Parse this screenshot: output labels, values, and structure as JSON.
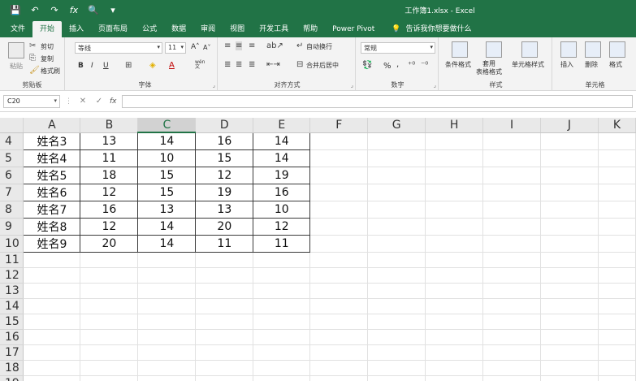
{
  "window": {
    "title": "工作簿1.xlsx  -  Excel"
  },
  "qat": {
    "save": "💾",
    "undo": "↶",
    "redo": "↷",
    "fx": "fx",
    "preview": "🔍",
    "more": "▾"
  },
  "tabs": [
    "文件",
    "开始",
    "插入",
    "页面布局",
    "公式",
    "数据",
    "审阅",
    "视图",
    "开发工具",
    "帮助",
    "Power Pivot"
  ],
  "active_tab": "开始",
  "tellme": {
    "icon": "💡",
    "text": "告诉我你想要做什么"
  },
  "ribbon": {
    "clipboard": {
      "label": "剪贴板",
      "paste": "粘贴",
      "cut": "剪切",
      "copy": "复制",
      "format_painter": "格式刷"
    },
    "font": {
      "label": "字体",
      "name": "等线",
      "size": "11",
      "grow": "A˄",
      "shrink": "A˅",
      "bold": "B",
      "italic": "I",
      "underline": "U",
      "wen": "wén\n文"
    },
    "alignment": {
      "label": "对齐方式",
      "wrap": "自动换行",
      "merge": "合并后居中"
    },
    "number": {
      "label": "数字",
      "format": "常规",
      "percent": "%",
      "comma": ","
    },
    "styles": {
      "label": "样式",
      "conditional": "条件格式",
      "table": "套用\n表格格式",
      "cell_styles": "单元格样式"
    },
    "cells": {
      "label": "单元格",
      "insert": "插入",
      "delete": "删除",
      "format": "格式"
    }
  },
  "formula_bar": {
    "name_box": "C20",
    "cancel": "✕",
    "enter": "✓",
    "fx": "fx",
    "value": ""
  },
  "columns": [
    "A",
    "B",
    "C",
    "D",
    "E",
    "F",
    "G",
    "H",
    "I",
    "J",
    "K"
  ],
  "selected_column": "C",
  "rows": [
    {
      "n": "4",
      "cells": [
        "姓名3",
        "13",
        "14",
        "16",
        "14"
      ]
    },
    {
      "n": "5",
      "cells": [
        "姓名4",
        "11",
        "10",
        "15",
        "14"
      ]
    },
    {
      "n": "6",
      "cells": [
        "姓名5",
        "18",
        "15",
        "12",
        "19"
      ]
    },
    {
      "n": "7",
      "cells": [
        "姓名6",
        "12",
        "15",
        "19",
        "16"
      ]
    },
    {
      "n": "8",
      "cells": [
        "姓名7",
        "16",
        "13",
        "13",
        "10"
      ]
    },
    {
      "n": "9",
      "cells": [
        "姓名8",
        "12",
        "14",
        "20",
        "12"
      ]
    },
    {
      "n": "10",
      "cells": [
        "姓名9",
        "20",
        "14",
        "11",
        "11"
      ]
    },
    {
      "n": "11",
      "cells": [
        "",
        "",
        "",
        "",
        ""
      ]
    },
    {
      "n": "12",
      "cells": [
        "",
        "",
        "",
        "",
        ""
      ]
    },
    {
      "n": "13",
      "cells": [
        "",
        "",
        "",
        "",
        ""
      ]
    },
    {
      "n": "14",
      "cells": [
        "",
        "",
        "",
        "",
        ""
      ]
    },
    {
      "n": "15",
      "cells": [
        "",
        "",
        "",
        "",
        ""
      ]
    },
    {
      "n": "16",
      "cells": [
        "",
        "",
        "",
        "",
        ""
      ]
    },
    {
      "n": "17",
      "cells": [
        "",
        "",
        "",
        "",
        ""
      ]
    },
    {
      "n": "18",
      "cells": [
        "",
        "",
        "",
        "",
        ""
      ]
    },
    {
      "n": "19",
      "cells": [
        "",
        "",
        "",
        "",
        ""
      ]
    }
  ],
  "colors": {
    "brand": "#217346"
  }
}
